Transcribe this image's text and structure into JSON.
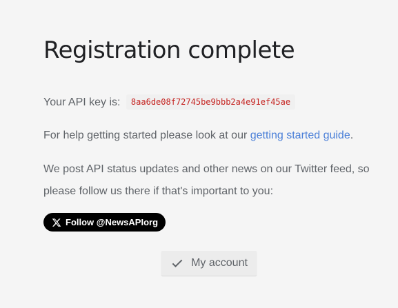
{
  "page": {
    "title": "Registration complete"
  },
  "api_key": {
    "label": "Your API key is:",
    "value": "8aa6de08f72745be9bbb2a4e91ef45ae"
  },
  "help": {
    "prefix": "For help getting started please look at our ",
    "link_text": "getting started guide",
    "suffix": "."
  },
  "news": {
    "text": "We post API status updates and other news on our Twitter feed, so please follow us there if that's important to you:"
  },
  "twitter_button": {
    "label": "Follow @NewsAPIorg",
    "icon": "x-logo-icon"
  },
  "account_button": {
    "label": "My account",
    "icon": "check-icon"
  },
  "colors": {
    "background": "#f5f5f5",
    "title": "#202124",
    "body_text": "#5f6368",
    "link": "#4a7fd8",
    "api_key_text": "#c5221f",
    "twitter_button_bg": "#000000"
  }
}
